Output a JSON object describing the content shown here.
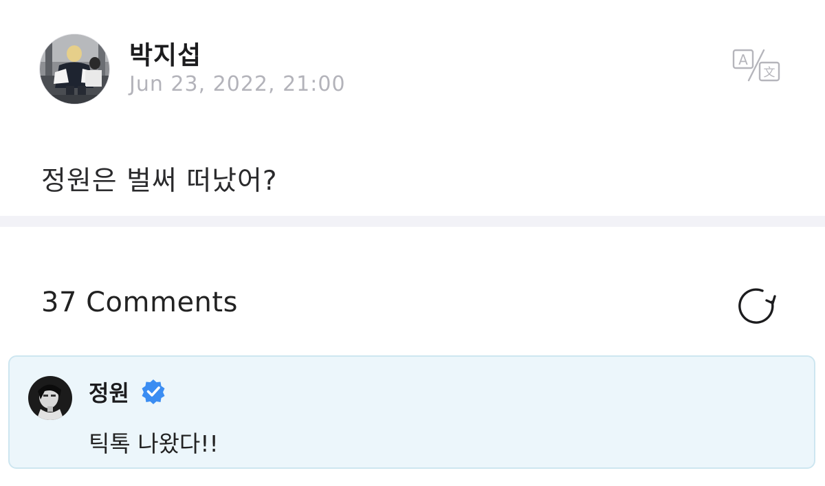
{
  "post": {
    "author": "박지섭",
    "date": "Jun 23, 2022, 21:00",
    "body": "정원은 벌써 떠났어?",
    "translate_icon": "translate-icon"
  },
  "comments": {
    "count_label": "37 Comments",
    "refresh_icon": "refresh-icon",
    "highlighted": {
      "author": "정원",
      "verified_icon": "verified-badge-icon",
      "text": "틱톡 나왔다!!"
    }
  },
  "colors": {
    "divider": "#f2f2f7",
    "date_gray": "#b3b3ba",
    "comment_bg": "#ecf6fb",
    "comment_border": "#cde6f0",
    "verified_blue": "#3b8df2"
  }
}
